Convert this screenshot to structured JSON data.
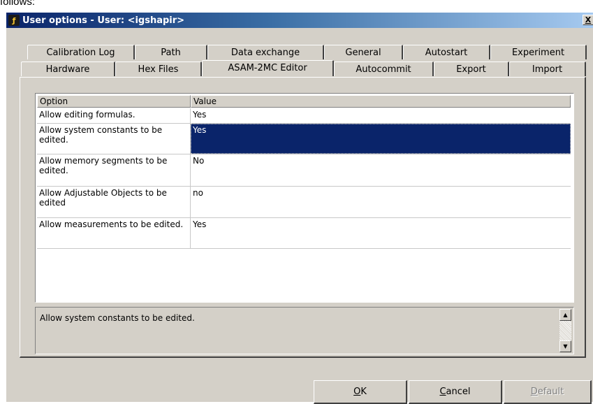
{
  "top_fragment": "follows:",
  "window": {
    "title": "User options - User: <igshapir>",
    "close_label": "X"
  },
  "tabs_back": [
    {
      "label": "Calibration Log"
    },
    {
      "label": "Path"
    },
    {
      "label": "Data exchange"
    },
    {
      "label": "General"
    },
    {
      "label": "Autostart"
    },
    {
      "label": "Experiment"
    }
  ],
  "tabs_front": [
    {
      "label": "Hardware"
    },
    {
      "label": "Hex Files"
    },
    {
      "label": "ASAM-2MC Editor",
      "active": true
    },
    {
      "label": "Autocommit"
    },
    {
      "label": "Export"
    },
    {
      "label": "Import"
    }
  ],
  "grid": {
    "columns": [
      "Option",
      "Value"
    ],
    "rows": [
      {
        "option": "Allow editing formulas.",
        "value": "Yes"
      },
      {
        "option": "Allow system constants to be edited.",
        "value": "Yes",
        "selected": true
      },
      {
        "option": "Allow memory segments to be edited.",
        "value": "No"
      },
      {
        "option": "Allow Adjustable Objects to be edited",
        "value": "no"
      },
      {
        "option": "Allow measurements to be edited.",
        "value": "Yes"
      }
    ]
  },
  "description": "Allow system constants to be edited.",
  "buttons": {
    "ok": {
      "pre": "",
      "key": "O",
      "post": "K"
    },
    "cancel": {
      "pre": "",
      "key": "C",
      "post": "ancel"
    },
    "default": {
      "pre": "",
      "key": "D",
      "post": "efault"
    }
  }
}
